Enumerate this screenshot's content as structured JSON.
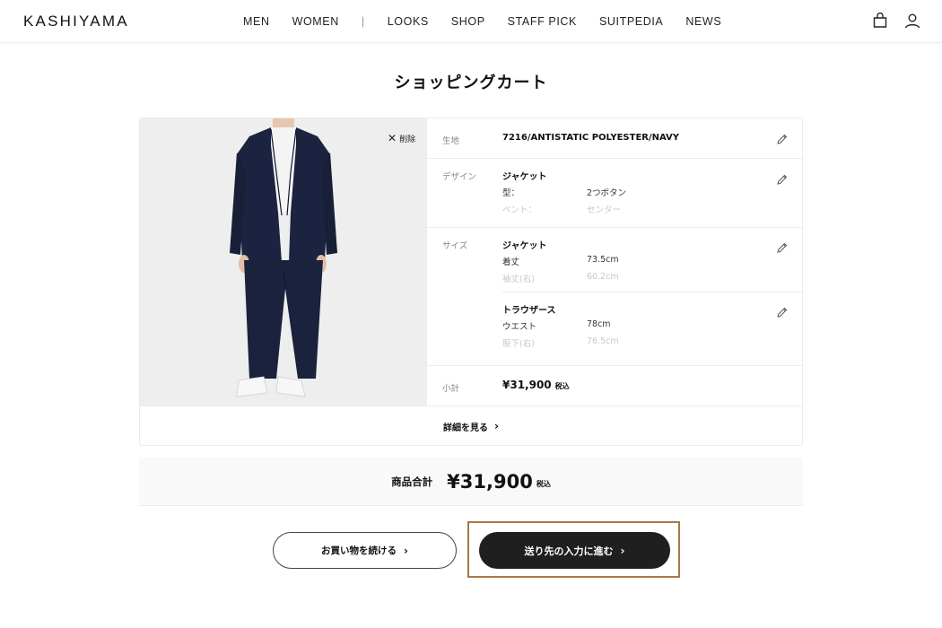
{
  "header": {
    "logo": "KASHIYAMA",
    "nav": [
      "MEN",
      "WOMEN",
      "|",
      "LOOKS",
      "SHOP",
      "STAFF PICK",
      "SUITPEDIA",
      "NEWS"
    ]
  },
  "page_title": "ショッピングカート",
  "item": {
    "delete_label": "削除",
    "fabric": {
      "label": "生地",
      "value": "7216/ANTISTATIC POLYESTER/NAVY"
    },
    "design": {
      "label": "デザイン",
      "type": "ジャケット",
      "rows": [
        {
          "k": "型：",
          "v": "2つボタン"
        },
        {
          "k": "ベント：",
          "v": "センター"
        }
      ]
    },
    "size": {
      "label": "サイズ",
      "jacket": {
        "type": "ジャケット",
        "rows": [
          {
            "k": "着丈",
            "v": "73.5cm"
          },
          {
            "k": "袖丈(右)",
            "v": "60.2cm"
          }
        ]
      },
      "trousers": {
        "type": "トラウザース",
        "rows": [
          {
            "k": "ウエスト",
            "v": "78cm"
          },
          {
            "k": "股下(右)",
            "v": "76.5cm"
          }
        ]
      }
    },
    "subtotal": {
      "label": "小計",
      "value": "¥31,900",
      "tax": "税込"
    },
    "see_details": "詳細を見る"
  },
  "total": {
    "label": "商品合計",
    "value": "¥31,900",
    "tax": "税込"
  },
  "buttons": {
    "continue": "お買い物を続ける",
    "proceed": "送り先の入力に進む"
  },
  "colors": {
    "accent_border": "#a5784a",
    "primary_button": "#1f1f1f",
    "suit_navy": "#1b2340"
  }
}
